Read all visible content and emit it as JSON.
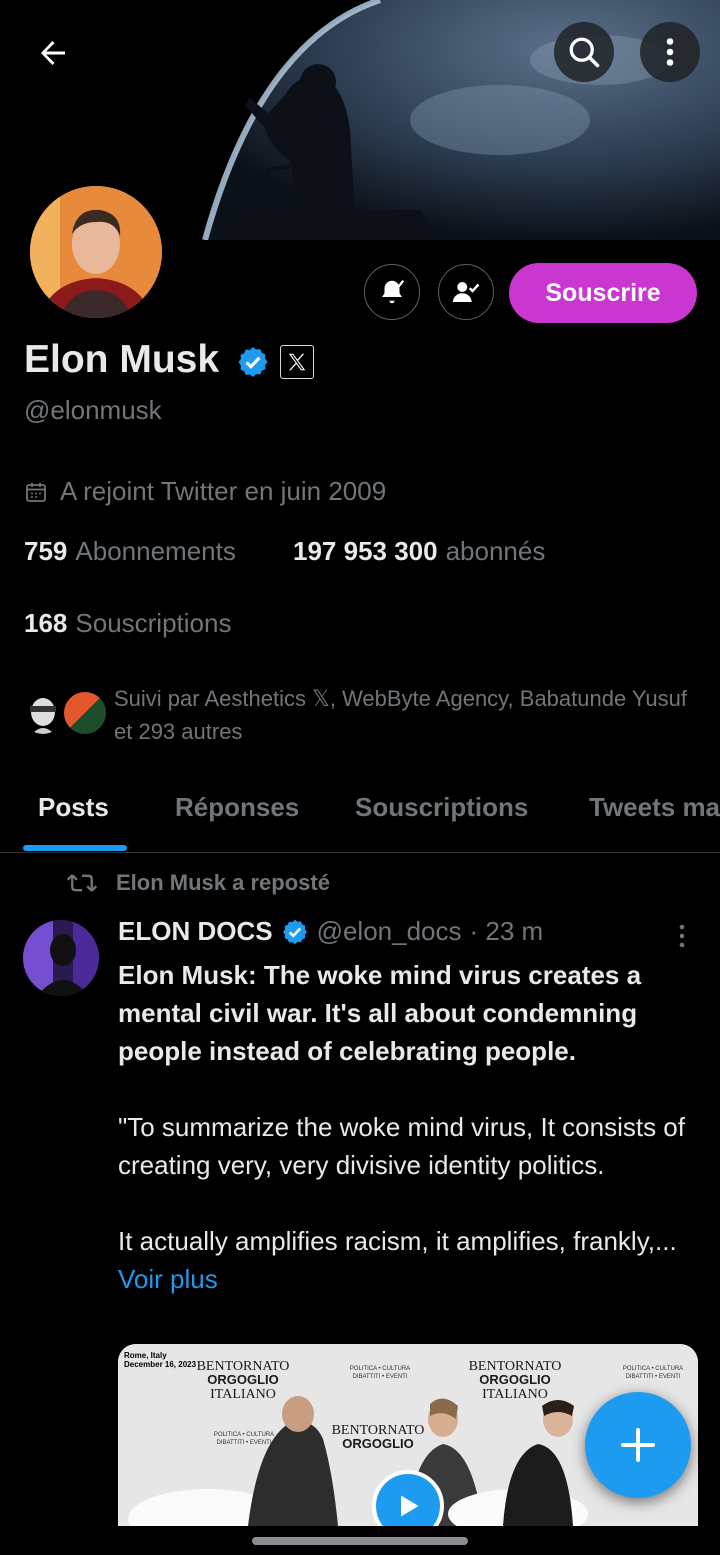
{
  "header": {
    "back_icon": "arrow-left-icon",
    "search_icon": "search-icon",
    "more_icon": "more-vertical-icon"
  },
  "profile": {
    "name": "Elon Musk",
    "handle": "@elonmusk",
    "verified_icon": "verified-badge-icon",
    "affiliate_icon": "x-logo-icon",
    "joined": "A rejoint Twitter en juin 2009",
    "subscribe_label": "Souscrire",
    "stats": {
      "following_count": "759",
      "following_label": "Abonnements",
      "followers_count": "197 953 300",
      "followers_label": "abonnés",
      "subscriptions_count": "168",
      "subscriptions_label": "Souscriptions"
    },
    "followed_by": "Suivi par Aesthetics 𝕏, WebByte Agency, Babatunde Yusuf et 293 autres"
  },
  "tabs": [
    {
      "label": "Posts",
      "active": true
    },
    {
      "label": "Réponses",
      "active": false
    },
    {
      "label": "Souscriptions",
      "active": false
    },
    {
      "label": "Tweets ma",
      "active": false
    }
  ],
  "post": {
    "repost_label": "Elon Musk a reposté",
    "author_name": "ELON DOCS",
    "author_handle": "@elon_docs",
    "time": "· 23 m",
    "lead": "Elon Musk: The woke mind virus creates a mental civil war. It's all about condemning people instead of celebrating people.",
    "para2": "\"To summarize the woke mind virus, It consists of creating very, very divisive identity politics.",
    "para3": "It actually amplifies racism, it amplifies, frankly,...",
    "more_label": "Voir plus",
    "media": {
      "location_text": "Rome, Italy",
      "date_text": "December 16, 2023",
      "sign_line1": "BENTORNATO",
      "sign_line2": "ORGOGLIO",
      "sign_line3": "ITALIANO",
      "sign_small": "POLITICA • CULTURA",
      "sign_small2": "DIBATTITI • EVENTI"
    }
  },
  "fab_icon": "plus-icon",
  "colors": {
    "accent": "#1d9bf0",
    "subscribe": "#c936d0",
    "background": "#000000",
    "muted": "#71767b"
  }
}
